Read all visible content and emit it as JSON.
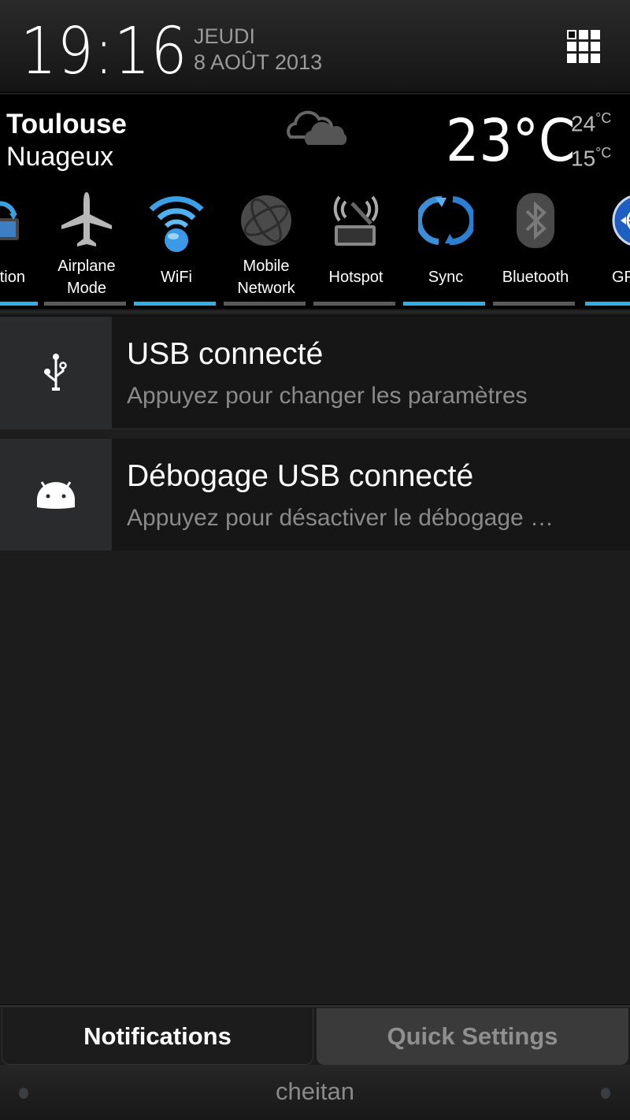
{
  "header": {
    "time": "19:16",
    "day": "JEUDI",
    "date": "8 AOÛT 2013",
    "apps_icon": "grid-icon"
  },
  "weather": {
    "city": "Toulouse",
    "condition": "Nuageux",
    "icon": "cloud-icon",
    "current": "23°C",
    "high": "24",
    "low": "15",
    "unit": "°C"
  },
  "toggles": [
    {
      "label": "Rotation",
      "visible_label": "tion",
      "icon": "rotation-icon",
      "on": true
    },
    {
      "label": "Airplane Mode",
      "line1": "Airplane",
      "line2": "Mode",
      "icon": "airplane-icon",
      "on": false
    },
    {
      "label": "WiFi",
      "icon": "wifi-icon",
      "on": true
    },
    {
      "label": "Mobile Network",
      "line1": "Mobile",
      "line2": "Network",
      "icon": "globe-icon",
      "on": false
    },
    {
      "label": "Hotspot",
      "icon": "hotspot-icon",
      "on": false
    },
    {
      "label": "Sync",
      "icon": "sync-icon",
      "on": true
    },
    {
      "label": "Bluetooth",
      "icon": "bluetooth-icon",
      "on": false
    },
    {
      "label": "GPS",
      "visible_label": "GP",
      "icon": "gps-icon",
      "on": true
    }
  ],
  "accent_color": "#2eb0e4",
  "notifications": [
    {
      "title": "USB connecté",
      "subtitle": "Appuyez pour changer les paramètres",
      "icon": "usb-icon"
    },
    {
      "title": "Débogage USB connecté",
      "subtitle": "Appuyez pour désactiver le débogage …",
      "icon": "android-icon"
    }
  ],
  "tabs": {
    "notifications": "Notifications",
    "quick_settings": "Quick Settings",
    "active": "notifications"
  },
  "handle": {
    "carrier": "cheitan"
  }
}
